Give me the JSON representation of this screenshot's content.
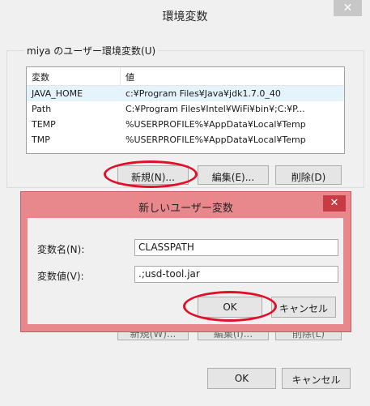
{
  "outer": {
    "title": "環境変数",
    "close_glyph": "✕",
    "group_label": "miya のユーザー環境変数(U)",
    "columns": [
      "変数",
      "値"
    ],
    "rows": [
      {
        "name": "JAVA_HOME",
        "value": "c:¥Program Files¥Java¥jdk1.7.0_40"
      },
      {
        "name": "Path",
        "value": "C:¥Program Files¥Intel¥WiFi¥bin¥;C:¥P..."
      },
      {
        "name": "TEMP",
        "value": "%USERPROFILE%¥AppData¥Local¥Temp"
      },
      {
        "name": "TMP",
        "value": "%USERPROFILE%¥AppData¥Local¥Temp"
      }
    ],
    "new_button": "新規(N)...",
    "edit_button": "編集(E)...",
    "delete_button": "削除(D)",
    "sys_new_button": "新規(W)...",
    "sys_edit_button": "編集(I)...",
    "sys_delete_button": "削除(L)",
    "ok_button": "OK",
    "cancel_button": "キャンセル"
  },
  "dialog": {
    "title": "新しいユーザー変数",
    "close_glyph": "✕",
    "name_label": "変数名(N):",
    "name_value": "CLASSPATH",
    "value_label": "変数値(V):",
    "value_value": ".;usd-tool.jar",
    "ok_button": "OK",
    "cancel_button": "キャンセル"
  },
  "colors": {
    "highlight": "#e0102a",
    "dialog_frame": "#e8888c",
    "close_button": "#c73c44"
  }
}
